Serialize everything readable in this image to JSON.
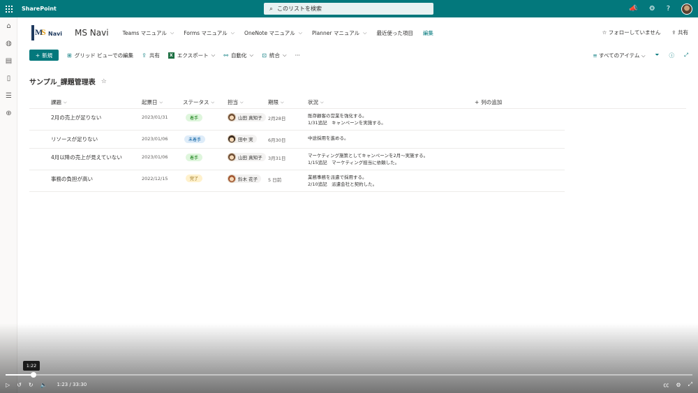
{
  "suitebar": {
    "brand": "SharePoint",
    "search_placeholder": "このリストを検索",
    "icons": [
      "waffle-icon",
      "megaphone-icon",
      "gear-icon",
      "help-icon",
      "account-avatar"
    ],
    "help_label": "?"
  },
  "rail": {
    "icons": [
      "home-icon",
      "globe-icon",
      "news-icon",
      "file-icon",
      "list-icon",
      "add-icon"
    ]
  },
  "site": {
    "logo_m": "M",
    "logo_s": "S",
    "logo_navi": "Navi",
    "title": "MS Navi",
    "nav": [
      {
        "label": "Teams マニュアル",
        "chevron": "⌵"
      },
      {
        "label": "Forms マニュアル",
        "chevron": "⌵"
      },
      {
        "label": "OneNote マニュアル",
        "chevron": "⌵"
      },
      {
        "label": "Planner マニュアル",
        "chevron": "⌵"
      },
      {
        "label": "最近使った項目",
        "chevron": ""
      }
    ],
    "edit_label": "編集",
    "follow_label": "☆ フォローしていません",
    "share_label": "共有"
  },
  "commandbar": {
    "new_label": "新規",
    "grid_edit": "グリッド ビューでの編集",
    "share": "共有",
    "export": "エクスポート",
    "automate": "自動化",
    "integrate": "統合",
    "more": "···",
    "view": "すべてのアイテム"
  },
  "list": {
    "title": "サンプル_課題管理表",
    "columns": [
      "課題",
      "起票日",
      "ステータス",
      "担当",
      "期限",
      "状況"
    ],
    "add_column": "列の追加",
    "rows": [
      {
        "issue": "2月の売上が足りない",
        "date": "2023/01/31",
        "status": "着手",
        "owner": "山田 真知子",
        "due": "2月28日",
        "note1": "既存顧客の営業を強化する。",
        "note2": "1/31追記　キャンペーンを実施する。"
      },
      {
        "issue": "リソースが足りない",
        "date": "2023/01/06",
        "status": "未着手",
        "owner": "田中 実",
        "due": "6月30日",
        "note1": "中途採用を進める。",
        "note2": ""
      },
      {
        "issue": "4月以降の売上が見えていない",
        "date": "2023/01/06",
        "status": "着手",
        "owner": "山田 真知子",
        "due": "3月31日",
        "note1": "マーケティング施策としてキャンペーンを2月～実施する。",
        "note2": "1/15追記　マーケティング担当に依頼した。"
      },
      {
        "issue": "事務の負担が高い",
        "date": "2022/12/15",
        "status": "完了",
        "owner": "鈴木 花子",
        "due": "5 日前",
        "note1": "業務事務を派遣で採用する。",
        "note2": "2/10追記　派遣会社と契約した。"
      }
    ],
    "status_colors": {
      "着手": "#dff6dd",
      "未着手": "#deecf9",
      "完了": "#fff1cc"
    },
    "status_text_colors": {
      "着手": "#107c10",
      "未着手": "#005a9e",
      "完了": "#8a6100"
    }
  },
  "video": {
    "tooltip": "1:22",
    "time": "1:23 / 33:30",
    "progress": 0.041
  }
}
